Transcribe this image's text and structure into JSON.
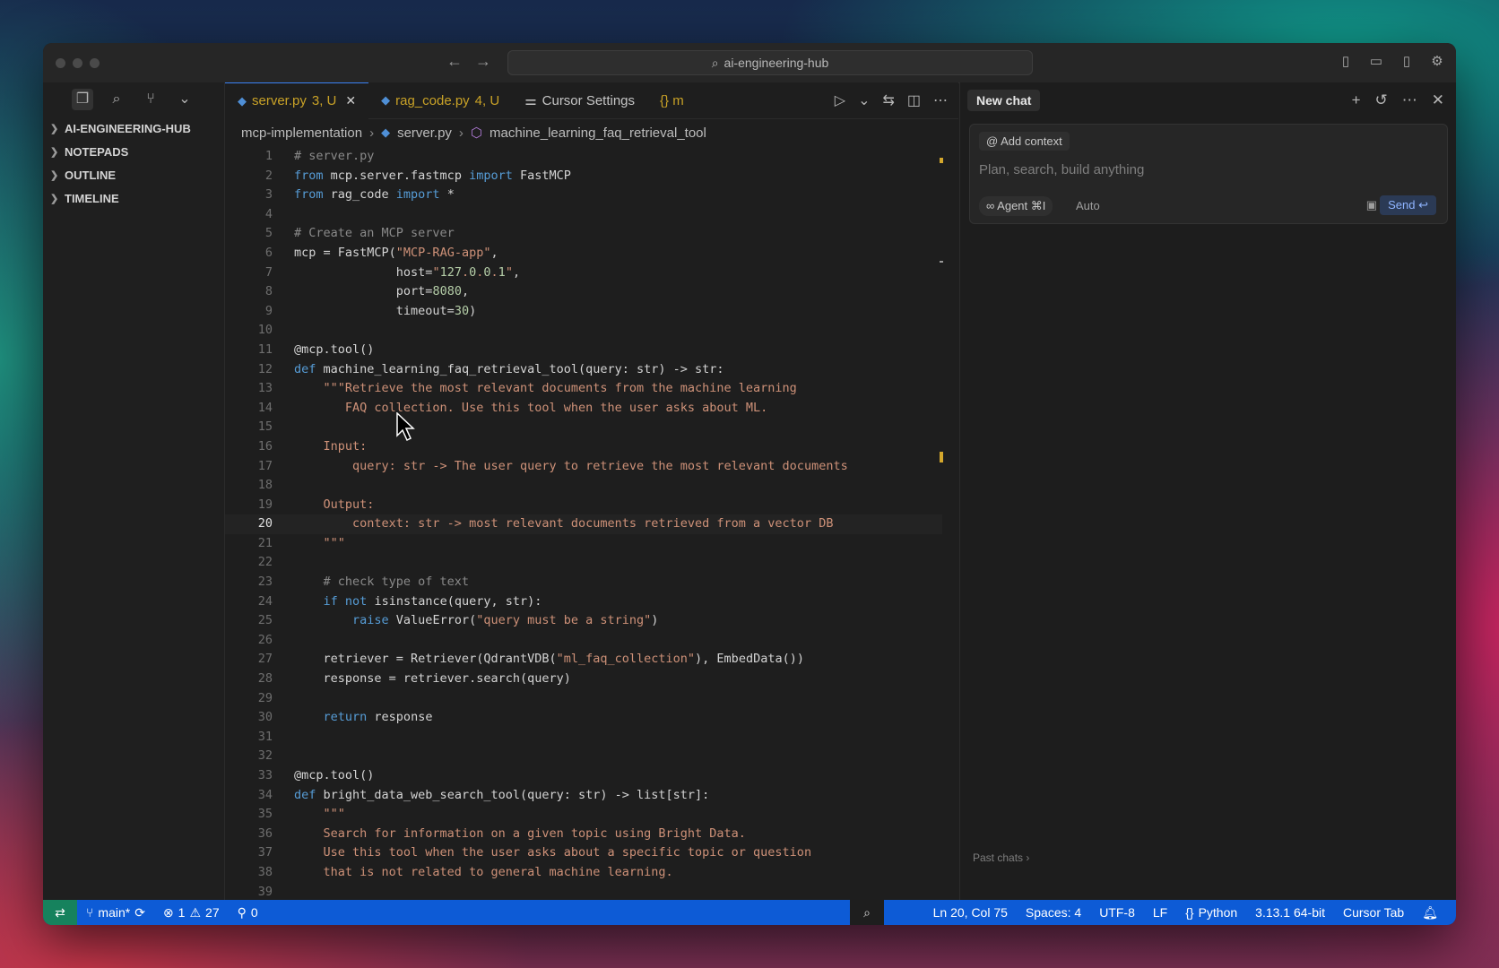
{
  "titlebar": {
    "search_text": "ai-engineering-hub"
  },
  "sidebar": {
    "sections": [
      {
        "label": "AI-ENGINEERING-HUB"
      },
      {
        "label": "NOTEPADS"
      },
      {
        "label": "OUTLINE"
      },
      {
        "label": "TIMELINE"
      }
    ]
  },
  "tabs": {
    "t1": {
      "label": "server.py",
      "status": "3, U",
      "color": "#c9a227"
    },
    "t2": {
      "label": "rag_code.py",
      "status": "4, U"
    },
    "t3": {
      "label": "Cursor Settings"
    },
    "t4": {
      "label": "{} m"
    }
  },
  "breadcrumb": {
    "folder": "mcp-implementation",
    "file": "server.py",
    "symbol": "machine_learning_faq_retrieval_tool"
  },
  "code": {
    "current_line": 20,
    "lines": [
      "# server.py",
      "from mcp.server.fastmcp import FastMCP",
      "from rag_code import *",
      "",
      "# Create an MCP server",
      "mcp = FastMCP(\"MCP-RAG-app\",",
      "              host=\"127.0.0.1\",",
      "              port=8080,",
      "              timeout=30)",
      "",
      "@mcp.tool()",
      "def machine_learning_faq_retrieval_tool(query: str) -> str:",
      "    \"\"\"Retrieve the most relevant documents from the machine learning",
      "       FAQ collection. Use this tool when the user asks about ML.",
      "",
      "    Input:",
      "        query: str -> The user query to retrieve the most relevant documents",
      "",
      "    Output:",
      "        context: str -> most relevant documents retrieved from a vector DB",
      "    \"\"\"",
      "",
      "    # check type of text",
      "    if not isinstance(query, str):",
      "        raise ValueError(\"query must be a string\")",
      "",
      "    retriever = Retriever(QdrantVDB(\"ml_faq_collection\"), EmbedData())",
      "    response = retriever.search(query)",
      "",
      "    return response",
      "",
      "",
      "@mcp.tool()",
      "def bright_data_web_search_tool(query: str) -> list[str]:",
      "    \"\"\"",
      "    Search for information on a given topic using Bright Data.",
      "    Use this tool when the user asks about a specific topic or question",
      "    that is not related to general machine learning.",
      ""
    ]
  },
  "chat": {
    "new_chat_label": "New chat",
    "add_context_label": "Add context",
    "input_placeholder": "Plan, search, build anything",
    "agent_label": "Agent ⌘I",
    "mode_label": "Auto",
    "send_label": "Send ↩",
    "past_chats_label": "Past chats ›"
  },
  "statusbar": {
    "branch": "main*",
    "errors": "1",
    "warnings": "27",
    "ports": "0",
    "position": "Ln 20, Col 75",
    "spaces": "Spaces: 4",
    "encoding": "UTF-8",
    "eol": "LF",
    "language": "Python",
    "interpreter": "3.13.1 64-bit",
    "cursor_tab": "Cursor Tab"
  },
  "colors": {
    "statusbar_bg": "#0d5bd6",
    "modified_tab": "#c9a227",
    "keyword": "#569cd6",
    "string": "#ce9178"
  }
}
